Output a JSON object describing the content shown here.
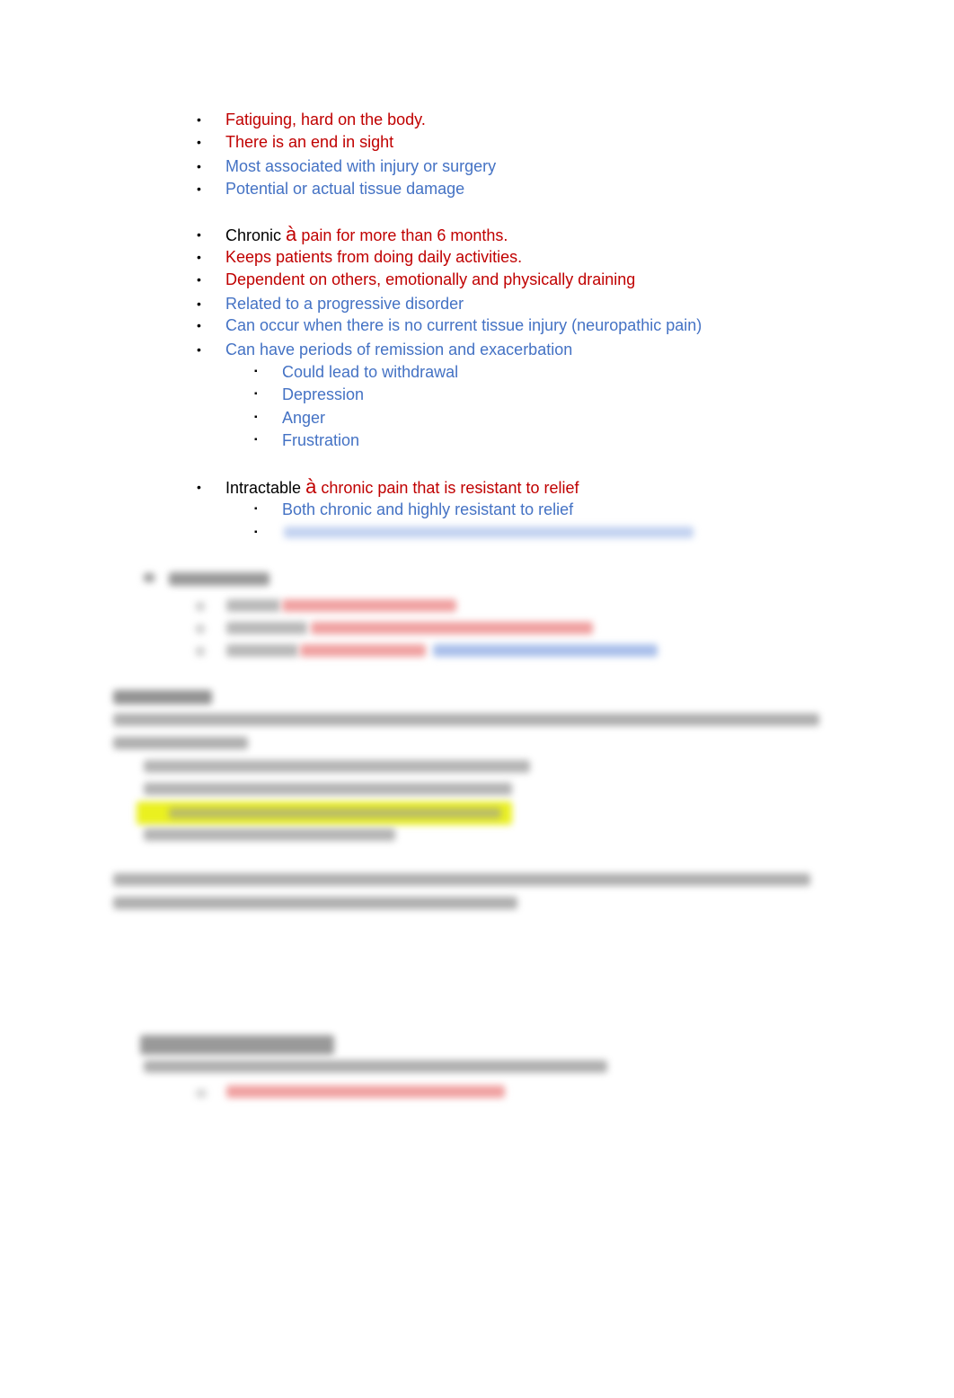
{
  "colors": {
    "red": "#c00000",
    "blue": "#4472c4",
    "highlight": "#eaf020"
  },
  "acute_items": [
    {
      "text": "Fatiguing, hard on the body.",
      "color": "red"
    },
    {
      "text": "There is an end in sight",
      "color": "red"
    },
    {
      "text": "Most associated with injury or surgery",
      "color": "blue"
    },
    {
      "text": "Potential or actual tissue damage",
      "color": "blue"
    }
  ],
  "chronic": {
    "label": "Chronic",
    "arrow": "à",
    "definition": "pain for more than 6 months.",
    "items": [
      {
        "text": "Keeps patients from doing daily activities.",
        "color": "red"
      },
      {
        "text": "Dependent on others, emotionally and physically draining",
        "color": "red"
      },
      {
        "text": "Related to a progressive disorder",
        "color": "blue"
      },
      {
        "text": "Can occur when there is no current tissue injury (neuropathic pain)",
        "color": "blue"
      },
      {
        "text": "Can have periods of remission and exacerbation",
        "color": "blue"
      }
    ],
    "subitems": [
      "Could lead to withdrawal",
      "Depression",
      "Anger",
      "Frustration"
    ]
  },
  "intractable": {
    "label": "Intractable",
    "arrow": "à",
    "definition": "chronic pain that is resistant to relief",
    "subitems": [
      "Both chronic and highly resistant to relief"
    ]
  },
  "bullet_glyphs": {
    "level1": "•",
    "level2": "▪"
  }
}
